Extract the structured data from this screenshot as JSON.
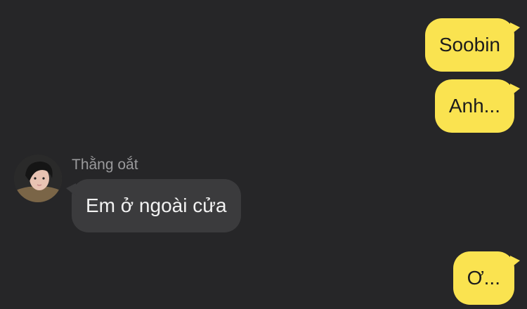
{
  "messages": [
    {
      "direction": "outgoing",
      "text": "Soobin"
    },
    {
      "direction": "outgoing",
      "text": "Anh..."
    },
    {
      "direction": "incoming",
      "sender": "Thằng oắt",
      "text": "Em ở ngoài cửa"
    },
    {
      "direction": "outgoing",
      "text": "Ơ..."
    }
  ],
  "colors": {
    "background": "#262628",
    "outgoing_bubble": "#fae350",
    "incoming_bubble": "#3b3b3d",
    "sender_name": "#9a9a9c"
  },
  "icons": {
    "avatar": "profile-photo-avatar"
  }
}
